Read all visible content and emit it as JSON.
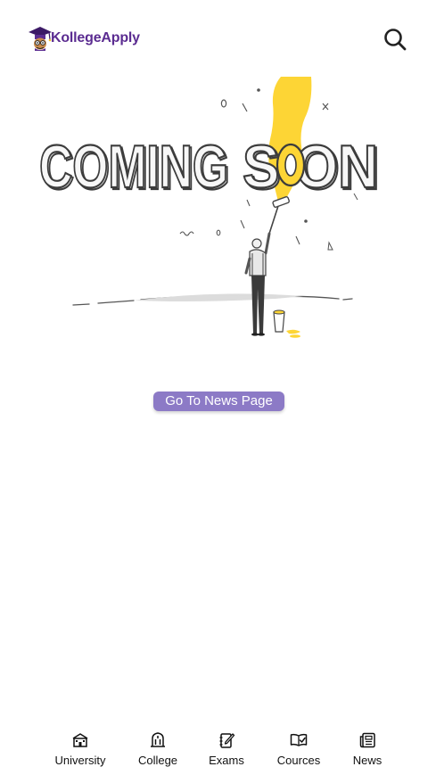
{
  "header": {
    "logo_text": "KollegeApply",
    "logo_icon": "graduate-mascot-icon",
    "search_icon": "search-icon"
  },
  "hero": {
    "image_text": "COMING SOON",
    "illustration": "painter-with-paint-roller",
    "accent_color": "#fdd535"
  },
  "cta": {
    "label": "Go To News Page",
    "color": "#8c7ac6"
  },
  "bottom_nav": {
    "items": [
      {
        "label": "University",
        "icon": "university-icon"
      },
      {
        "label": "College",
        "icon": "college-icon"
      },
      {
        "label": "Exams",
        "icon": "exams-icon"
      },
      {
        "label": "Cources",
        "icon": "courses-icon"
      },
      {
        "label": "News",
        "icon": "news-icon"
      }
    ]
  },
  "colors": {
    "brand": "#5b2c91",
    "background": "#ffffff",
    "text": "#111111"
  }
}
